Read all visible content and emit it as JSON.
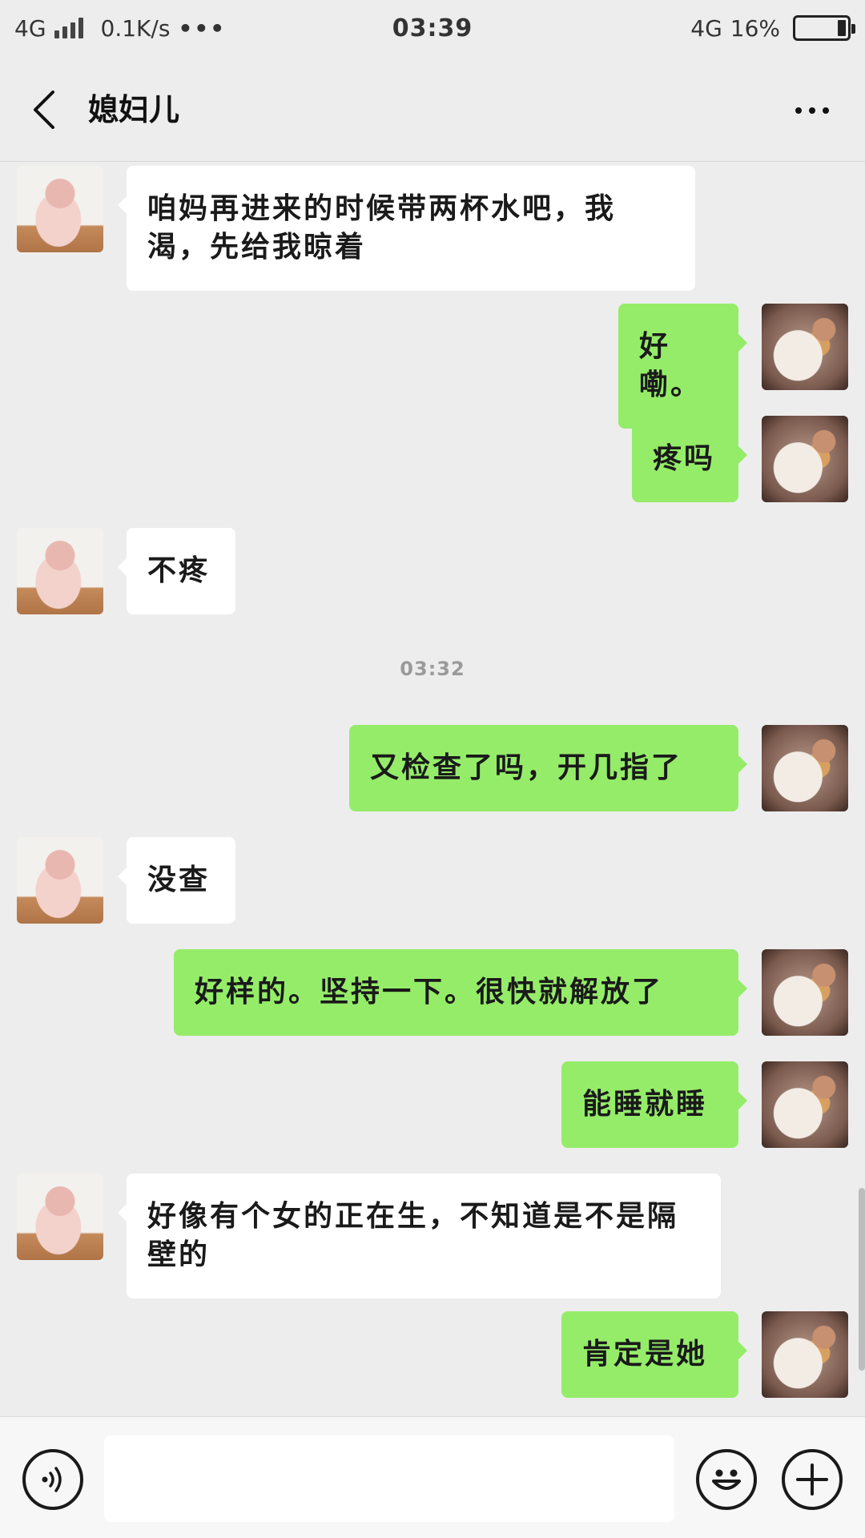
{
  "status_bar": {
    "network": "4G",
    "speed": "0.1K/s",
    "dots": "•••",
    "time": "03:39",
    "network_right": "4G",
    "battery": "16%"
  },
  "header": {
    "title": "媳妇儿"
  },
  "messages": [
    {
      "side": "recv",
      "text": "咱妈再进来的时候带两杯水吧，我渴，先给我晾着"
    },
    {
      "side": "sent",
      "text": "好嘞。"
    },
    {
      "side": "sent",
      "text": "疼吗"
    },
    {
      "side": "recv",
      "text": "不疼"
    },
    {
      "side": "sent",
      "text": "又检查了吗，开几指了"
    },
    {
      "side": "recv",
      "text": "没查"
    },
    {
      "side": "sent",
      "text": "好样的。坚持一下。很快就解放了"
    },
    {
      "side": "sent",
      "text": "能睡就睡"
    },
    {
      "side": "recv",
      "text": "好像有个女的正在生，不知道是不是隔壁的"
    },
    {
      "side": "sent",
      "text": "肯定是她"
    }
  ],
  "timestamps": [
    "03:32"
  ],
  "input_bar": {
    "voice_icon": "voice-icon",
    "emoji_icon": "emoji-icon",
    "plus_icon": "plus-icon",
    "input_value": ""
  },
  "colors": {
    "background": "#ededed",
    "sent_bubble": "#95ec69",
    "recv_bubble": "#ffffff"
  }
}
